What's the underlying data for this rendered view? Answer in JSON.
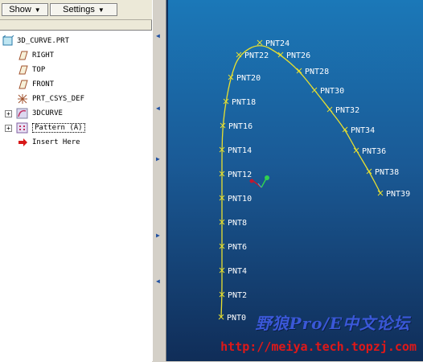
{
  "toolbar": {
    "show_label": "Show",
    "settings_label": "Settings"
  },
  "tree": {
    "root_label": "3D_CURVE.PRT",
    "items": [
      {
        "label": "RIGHT",
        "icon": "datum-plane-icon"
      },
      {
        "label": "TOP",
        "icon": "datum-plane-icon"
      },
      {
        "label": "FRONT",
        "icon": "datum-plane-icon"
      },
      {
        "label": "PRT_CSYS_DEF",
        "icon": "csys-icon"
      },
      {
        "label": "3DCURVE",
        "icon": "curve-feature-icon"
      },
      {
        "label": "Pattern (A)",
        "icon": "pattern-icon"
      },
      {
        "label": "Insert Here",
        "icon": "insert-arrow-icon"
      }
    ]
  },
  "graphics": {
    "points": [
      {
        "label": "PNT0"
      },
      {
        "label": "PNT2"
      },
      {
        "label": "PNT4"
      },
      {
        "label": "PNT6"
      },
      {
        "label": "PNT8"
      },
      {
        "label": "PNT10"
      },
      {
        "label": "PNT12"
      },
      {
        "label": "PNT14"
      },
      {
        "label": "PNT16"
      },
      {
        "label": "PNT18"
      },
      {
        "label": "PNT20"
      },
      {
        "label": "PNT22"
      },
      {
        "label": "PNT24"
      },
      {
        "label": "PNT26"
      },
      {
        "label": "PNT28"
      },
      {
        "label": "PNT30"
      },
      {
        "label": "PNT32"
      },
      {
        "label": "PNT34"
      },
      {
        "label": "PNT36"
      },
      {
        "label": "PNT38"
      },
      {
        "label": "PNT39"
      }
    ],
    "curve_color": "#e8e030",
    "marker_color": "#e8e030",
    "label_color": "#ffffff"
  },
  "watermark": {
    "text_cn": "野狼Pro/E中文论坛",
    "url": "http://meiya.tech.topzj.com"
  }
}
